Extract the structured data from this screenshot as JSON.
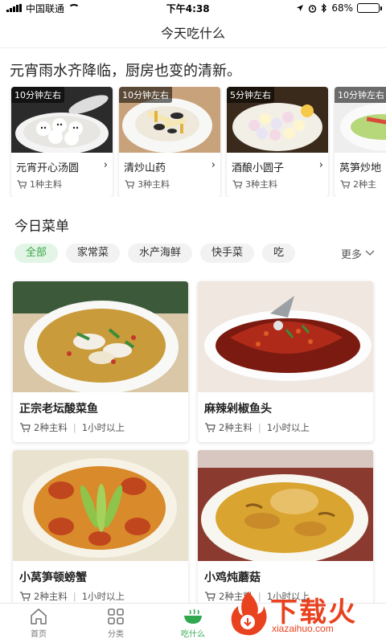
{
  "status": {
    "carrier": "中国联通",
    "time": "下午4:38",
    "battery": "68%",
    "battery_level": 0.68
  },
  "nav": {
    "title": "今天吃什么"
  },
  "banner": {
    "title": "元宵雨水齐降临，厨房也变的清新。",
    "recipes": [
      {
        "time": "10分钟左右",
        "name": "元宵开心汤圆",
        "main": "1种主料"
      },
      {
        "time": "10分钟左右",
        "name": "清炒山药",
        "main": "3种主料"
      },
      {
        "time": "5分钟左右",
        "name": "酒酿小圆子",
        "main": "3种主料"
      },
      {
        "time": "10分钟左右",
        "name": "莴笋炒地",
        "main": "2种主"
      }
    ]
  },
  "menu": {
    "title": "今日菜单",
    "chips": [
      "全部",
      "家常菜",
      "水产海鲜",
      "快手菜",
      "吃"
    ],
    "more_label": "更多"
  },
  "dishes": [
    {
      "name": "正宗老坛酸菜鱼",
      "main": "2种主料",
      "time": "1小时以上"
    },
    {
      "name": "麻辣剁椒鱼头",
      "main": "2种主料",
      "time": "1小时以上"
    },
    {
      "name": "小莴笋顿螃蟹",
      "main": "2种主料",
      "time": "1小时以上"
    },
    {
      "name": "小鸡炖蘑菇",
      "main": "2种主料",
      "time": "1小时以上"
    }
  ],
  "tabs": [
    {
      "label": "首页",
      "icon": "home-icon"
    },
    {
      "label": "分类",
      "icon": "grid-icon"
    },
    {
      "label": "吃什么",
      "icon": "bowl-icon"
    }
  ],
  "watermark": {
    "text": "下载火",
    "url": "xiazaihuo.com"
  },
  "colors": {
    "accent": "#2fa84f",
    "chip_active_bg": "#e3f5e6",
    "watermark": "#e8421f"
  }
}
